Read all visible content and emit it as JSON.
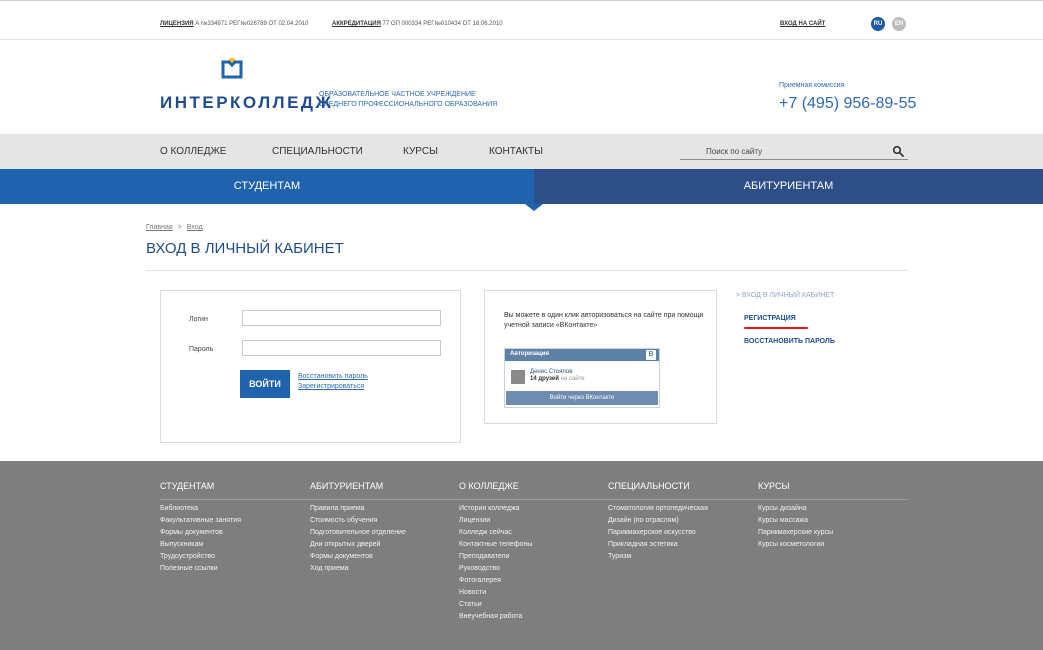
{
  "top_bar": {
    "license_link": "ЛИЦЕНЗИЯ",
    "license_text": " А №334971 РЕГ№026789 ОТ 02.04.2010",
    "accreditation_link": "АККРЕДИТАЦИЯ",
    "accreditation_text": " 77 ОП 000334 РЕГ№010434 ОТ 18.06.2010",
    "login_link": "ВХОД НА САЙТ",
    "lang_ru": "RU",
    "lang_en": "EN"
  },
  "header": {
    "logo_text": "ИНТЕРКОЛЛЕДЖ",
    "org_line1": "ОБРАЗОВАТЕЛЬНОЕ ЧАСТНОЕ УЧРЕЖДЕНИЕ",
    "org_line2": "СРЕДНЕГО ПРОФЕССИОНАЛЬНОГО ОБРАЗОВАНИЯ",
    "admission_label": "Приемная комиссия",
    "admission_phone": "+7 (495) 956-89-55"
  },
  "nav": {
    "items": [
      "О КОЛЛЕДЖЕ",
      "СПЕЦИАЛЬНОСТИ",
      "КУРСЫ",
      "КОНТАКТЫ"
    ],
    "search_placeholder": "Поиск по сайту"
  },
  "tabs": {
    "students": "СТУДЕНТАМ",
    "applicants": "АБИТУРИЕНТАМ"
  },
  "breadcrumb": {
    "home": "Главная",
    "separator": ">",
    "current": "Вход"
  },
  "page_title": "ВХОД В ЛИЧНЫЙ КАБИНЕТ",
  "login_form": {
    "login_label": "Логин",
    "password_label": "Пароль",
    "login_value": "",
    "password_value": "",
    "submit_label": "ВОЙТИ",
    "restore_link": "Восстановить пароль",
    "register_link": "Зарегистрироваться"
  },
  "vk": {
    "text": "Вы можете в один клик авторизоваться на сайте при помощи учетной записи «ВКонтакте»",
    "widget_title": "Авторизация",
    "logo": "B",
    "user_name": "Денис Стоялов",
    "friends_count": "14 друзей",
    "friends_suffix": " на сайте",
    "button_label": "Войти через ВКонтакте"
  },
  "side_menu": {
    "items": [
      {
        "label": "ВХОД В ЛИЧНЫЙ КАБИНЕТ",
        "prefix": ">  "
      },
      {
        "label": "РЕГИСТРАЦИЯ"
      },
      {
        "label": "ВОССТАНОВИТЬ ПАРОЛЬ"
      }
    ],
    "underline_color": "#e21a1a"
  },
  "footer": {
    "columns": [
      {
        "title": "СТУДЕНТАМ",
        "items": [
          "Библиотека",
          "Факультативные занятия",
          "Формы документов",
          "Выпускникам",
          "Трудоустройство",
          "Полезные ссылки"
        ]
      },
      {
        "title": "АБИТУРИЕНТАМ",
        "items": [
          "Правила приема",
          "Стоимость обучения",
          "Подготовительное отделение",
          "Дни открытых дверей",
          "Формы документов",
          "Ход приема"
        ]
      },
      {
        "title": "О КОЛЛЕДЖЕ",
        "items": [
          "История колледжа",
          "Лицензии",
          "Колледж сейчас",
          "Контактные телефоны",
          "Преподаватели",
          "Руководство",
          "Фотогалерея",
          "Новости",
          "Статьи",
          "Внеучебная работа"
        ]
      },
      {
        "title": "СПЕЦИАЛЬНОСТИ",
        "items": [
          "Стоматология ортопедическая",
          "Дизайн (по отраслям)",
          "Парикмахерское искусство",
          "Прикладная эстетика",
          "Туризм"
        ]
      },
      {
        "title": "КУРСЫ",
        "items": [
          "Курсы дизайна",
          "Курсы массажа",
          "Парикмахерские курсы",
          "Курсы косметологии"
        ]
      }
    ]
  },
  "colors": {
    "brand_blue": "#1f62ae",
    "dark_blue": "#2d4e87",
    "footer_gray": "#7e7e7e"
  }
}
